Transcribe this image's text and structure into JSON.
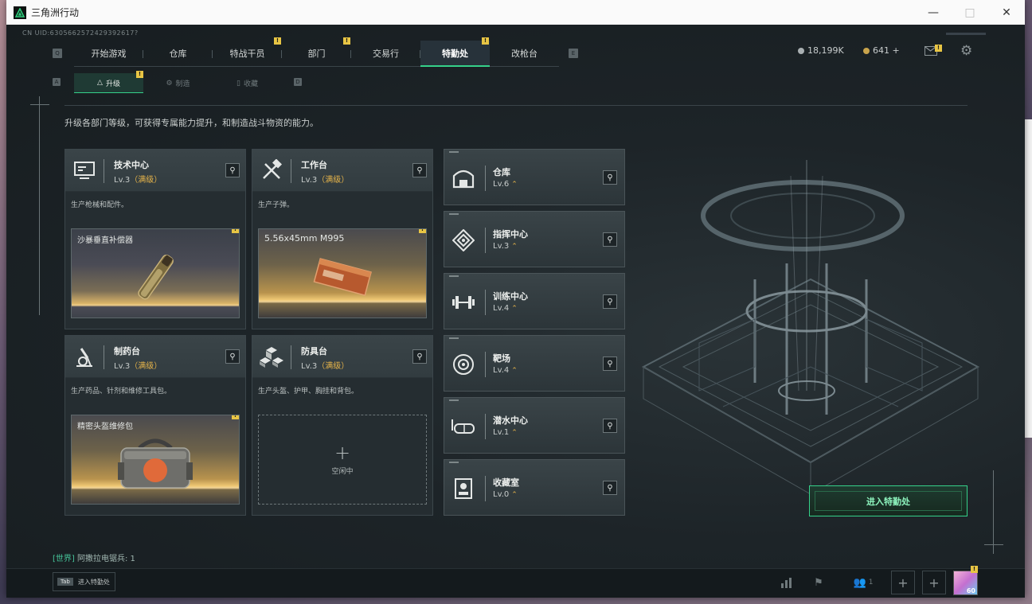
{
  "window": {
    "title": "三角洲行动",
    "min_icon": "minimize-icon",
    "max_icon": "maximize-icon",
    "close_icon": "close-icon"
  },
  "uid": "CN UID:6305662572429392617?",
  "nav": {
    "left_key": "Q",
    "right_key": "E",
    "tabs": [
      {
        "label": "开始游戏",
        "badge": ""
      },
      {
        "label": "仓库",
        "badge": ""
      },
      {
        "label": "特战干员",
        "badge": "!"
      },
      {
        "label": "部门",
        "badge": "!"
      },
      {
        "label": "交易行",
        "badge": ""
      },
      {
        "label": "特勤处",
        "badge": "!",
        "active": true
      },
      {
        "label": "改枪台",
        "badge": ""
      }
    ]
  },
  "currency": {
    "silver": "18,199K",
    "gold": "641 +"
  },
  "subnav": {
    "left_key": "A",
    "right_key": "D",
    "tabs": [
      {
        "label": "升级",
        "badge": "!",
        "active": true
      },
      {
        "label": "制造",
        "badge": ""
      },
      {
        "label": "收藏",
        "badge": ""
      }
    ]
  },
  "description": "升级各部门等级，可获得专属能力提升，和制造战斗物资的能力。",
  "main_cards": [
    {
      "name": "技术中心",
      "level": "Lv.3",
      "max": "（满级）",
      "sub": "生产枪械和配件。",
      "item": "沙暴垂直补偿器"
    },
    {
      "name": "工作台",
      "level": "Lv.3",
      "max": "（满级）",
      "sub": "生产子弹。",
      "item": "5.56x45mm M995"
    },
    {
      "name": "制药台",
      "level": "Lv.3",
      "max": "（满级）",
      "sub": "生产药品、针剂和维修工具包。",
      "item": "精密头盔维修包"
    },
    {
      "name": "防具台",
      "level": "Lv.3",
      "max": "（满级）",
      "sub": "生产头盔、护甲、胸挂和背包。",
      "empty": "空闲中"
    }
  ],
  "buildings": [
    {
      "name": "仓库",
      "level": "Lv.6"
    },
    {
      "name": "指挥中心",
      "level": "Lv.3"
    },
    {
      "name": "训练中心",
      "level": "Lv.4"
    },
    {
      "name": "靶场",
      "level": "Lv.4"
    },
    {
      "name": "潜水中心",
      "level": "Lv.1"
    },
    {
      "name": "收藏室",
      "level": "Lv.0"
    }
  ],
  "enter_button": "进入特勤处",
  "chat": {
    "channel": "[世界]",
    "text": " 阿撒拉电锯兵: 1"
  },
  "bottom": {
    "tab_key": "Tab",
    "tab_label": "进入特勤处",
    "team_count": "1",
    "avatar_level": "60"
  },
  "colors": {
    "accent": "#35d18a",
    "badge": "#e8c544",
    "max": "#e6b44a"
  }
}
